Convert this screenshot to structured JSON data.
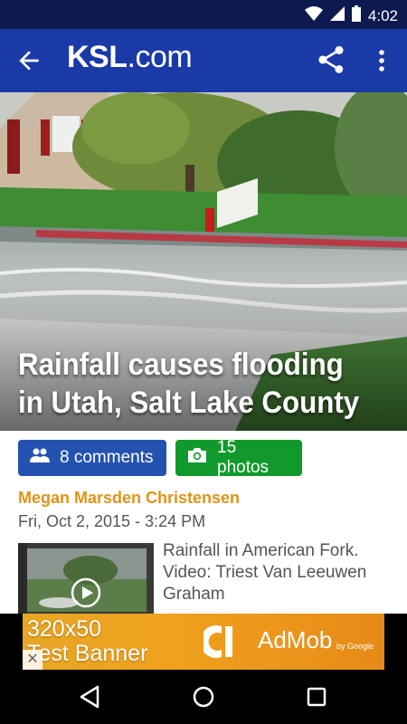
{
  "status_bar": {
    "time": "4:02"
  },
  "app_bar": {
    "logo_main": "KSL",
    "logo_suffix": ".com"
  },
  "article": {
    "title": "Rainfall causes flooding in Utah, Salt Lake County",
    "comments_label": "8 comments",
    "photos_label": "15 photos",
    "author": "Megan Marsden Christensen",
    "date": "Fri, Oct 2, 2015 - 3:24 PM",
    "video_caption": "Rainfall in American Fork. Video: Triest Van Leeuwen Graham"
  },
  "ad": {
    "text_line1": "320x50",
    "text_line2": "Test Banner",
    "brand": "AdMob",
    "brand_by": "by Google",
    "close_glyph": "✕"
  },
  "icons": [
    "wifi-icon",
    "signal-icon",
    "battery-icon",
    "back-arrow-icon",
    "share-icon",
    "more-vert-icon",
    "people-icon",
    "camera-icon",
    "play-icon",
    "nav-back-icon",
    "nav-home-icon",
    "nav-recents-icon"
  ],
  "colors": {
    "app_bar": "#1a3aa8",
    "status_bar": "#0d1a4f",
    "comments_chip": "#2352b0",
    "photos_chip": "#119a2b",
    "author": "#e09418"
  }
}
